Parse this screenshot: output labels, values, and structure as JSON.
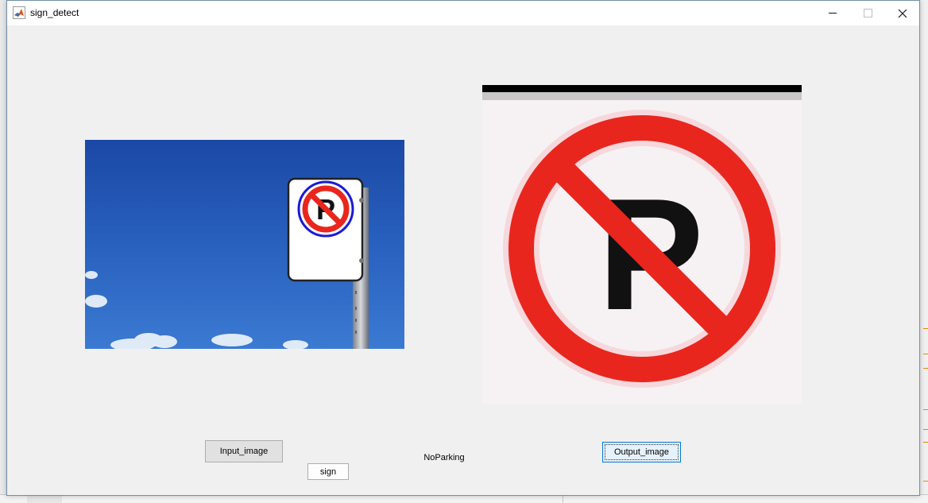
{
  "window": {
    "title": "sign_detect",
    "controls": {
      "minimize": "minimize-icon",
      "maximize": "maximize-icon",
      "close": "close-icon"
    }
  },
  "buttons": {
    "input_image": "Input_image",
    "sign": "sign",
    "output_image": "Output_image"
  },
  "result": {
    "label": "NoParking"
  },
  "images": {
    "input": "photo of a no-parking sign on a pole against a blue sky",
    "output": "enlarged cropped no-parking sign"
  },
  "colors": {
    "sign_red": "#e8261e",
    "sky_blue": "#1e50ad",
    "window_bg": "#f0f0f0",
    "focus_blue": "#0078d7"
  }
}
